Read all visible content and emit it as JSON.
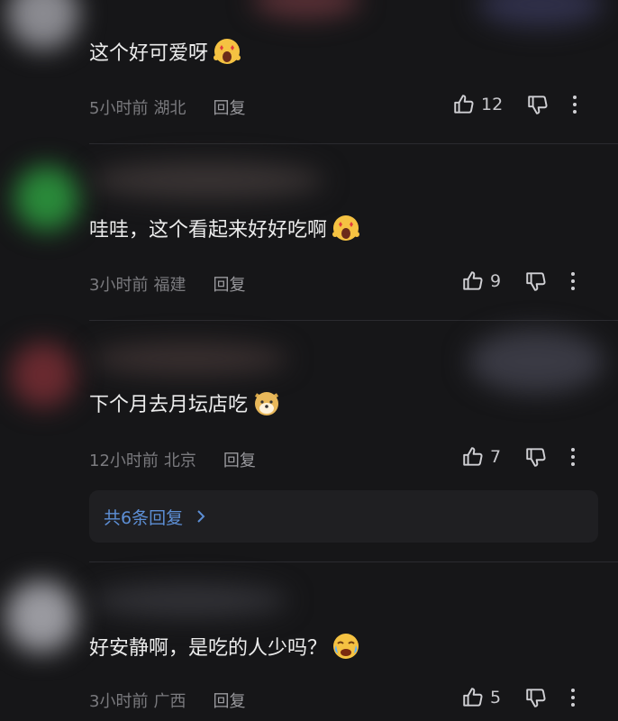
{
  "comments": [
    {
      "text": "这个好可爱呀",
      "emoji_icon": "starstruck-face-icon",
      "time": "5小时前",
      "location": "湖北",
      "reply_label": "回复",
      "likes": "12"
    },
    {
      "text": "哇哇，这个看起来好好吃啊",
      "emoji_icon": "starstruck-face-icon",
      "time": "3小时前",
      "location": "福建",
      "reply_label": "回复",
      "likes": "9"
    },
    {
      "text": "下个月去月坛店吃",
      "emoji_icon": "doge-face-icon",
      "time": "12小时前",
      "location": "北京",
      "reply_label": "回复",
      "likes": "7"
    },
    {
      "text": "好安静啊，是吃的人少吗？",
      "emoji_icon": "crying-face-icon",
      "time": "3小时前",
      "location": "广西",
      "reply_label": "回复",
      "likes": "5"
    }
  ],
  "replies_link": "共6条回复",
  "colors": {
    "background": "#161618",
    "text": "#ececec",
    "meta": "#7a7a7e",
    "link": "#5d8fd6"
  }
}
